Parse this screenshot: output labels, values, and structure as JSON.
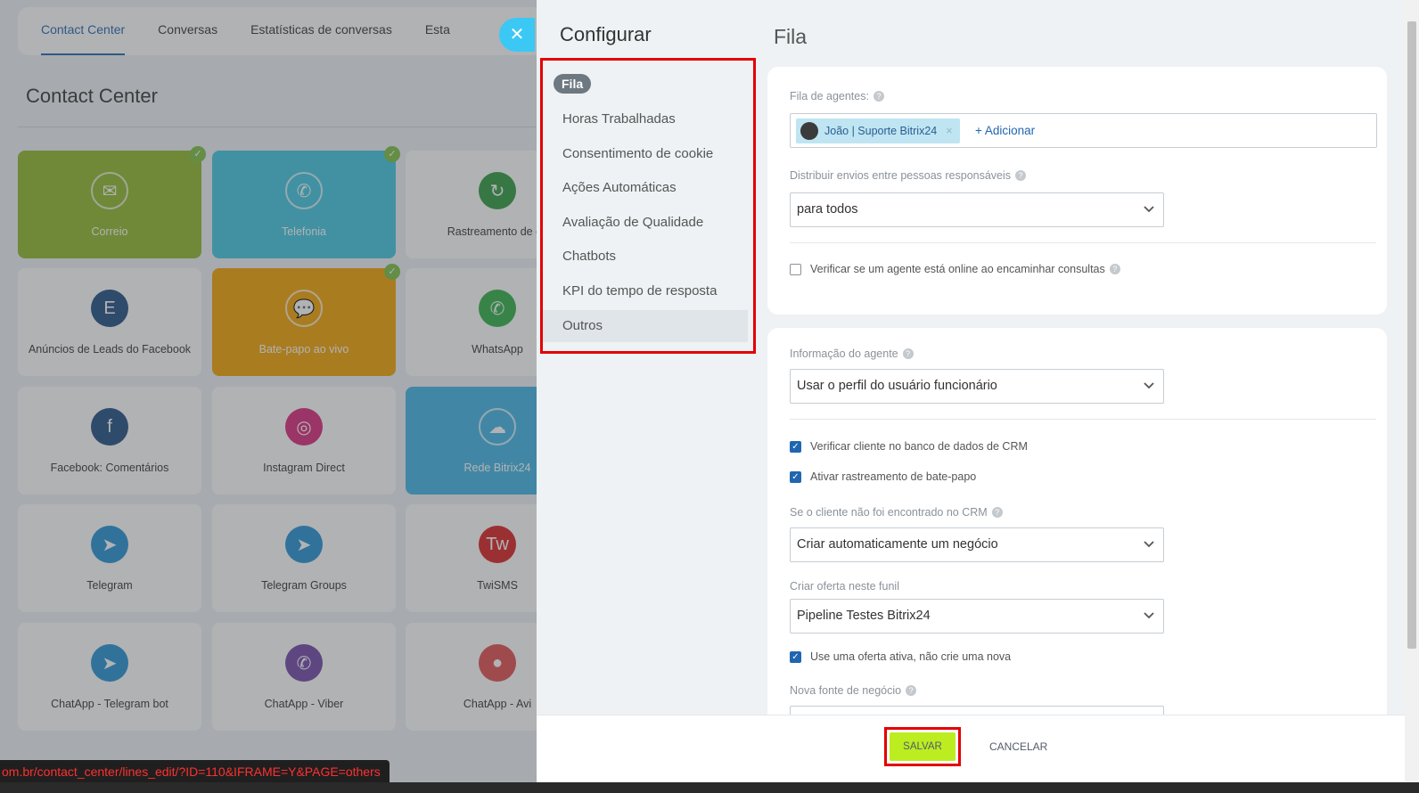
{
  "background": {
    "tabs": [
      "Contact Center",
      "Conversas",
      "Estatísticas de conversas",
      "Esta"
    ],
    "active_tab": "Contact Center",
    "page_title": "Contact Center",
    "tiles": [
      {
        "label": "Correio",
        "color": "#8db82a",
        "icon": "mail-icon",
        "glyph": "✉",
        "checked": true
      },
      {
        "label": "Telefonia",
        "color": "#3fc6e0",
        "icon": "phone-icon",
        "glyph": "✆",
        "checked": true
      },
      {
        "label": "Rastreamento de ch",
        "color": "",
        "icon": "call-tracking-icon",
        "glyph": "↻",
        "checked": false
      },
      {
        "label": "Anúncios de Leads do Facebook",
        "color": "",
        "icon": "facebook-leads-icon",
        "glyph": "E",
        "checked": false
      },
      {
        "label": "Bate-papo ao vivo",
        "color": "#f2a200",
        "icon": "live-chat-icon",
        "glyph": "💬",
        "checked": true
      },
      {
        "label": "WhatsApp",
        "color": "",
        "icon": "whatsapp-icon",
        "glyph": "✆",
        "checked": false
      },
      {
        "label": "Facebook: Comentários",
        "color": "",
        "icon": "facebook-comments-icon",
        "glyph": "f",
        "checked": false
      },
      {
        "label": "Instagram Direct",
        "color": "",
        "icon": "instagram-icon",
        "glyph": "◎",
        "checked": false
      },
      {
        "label": "Rede Bitrix24",
        "color": "#3fb6e6",
        "icon": "cloud-icon",
        "glyph": "☁",
        "checked": false
      },
      {
        "label": "Telegram",
        "color": "",
        "icon": "telegram-icon",
        "glyph": "➤",
        "checked": false
      },
      {
        "label": "Telegram Groups",
        "color": "",
        "icon": "telegram-groups-icon",
        "glyph": "➤",
        "checked": false
      },
      {
        "label": "TwiSMS",
        "color": "",
        "icon": "twisms-icon",
        "glyph": "Tw",
        "checked": false
      },
      {
        "label": "ChatApp - Telegram bot",
        "color": "",
        "icon": "telegram-bot-icon",
        "glyph": "➤",
        "checked": false
      },
      {
        "label": "ChatApp - Viber",
        "color": "",
        "icon": "viber-icon",
        "glyph": "✆",
        "checked": false
      },
      {
        "label": "ChatApp - Avi",
        "color": "",
        "icon": "avito-icon",
        "glyph": "●",
        "checked": false
      }
    ],
    "icon_colors": [
      "#8db82a",
      "#3fc6e0",
      "#2e9a3e",
      "#1f4f82",
      "#f2a200",
      "#2fb046",
      "#1f4f82",
      "#d9267a",
      "#3fb6e6",
      "#2492d4",
      "#2492d4",
      "#d92020",
      "#2492d4",
      "#7047a8",
      "#e04e4e"
    ],
    "status_url": "om.br/contact_center/lines_edit/?ID=110&IFRAME=Y&PAGE=others"
  },
  "panel": {
    "title": "Configurar",
    "nav": [
      "Fila",
      "Horas Trabalhadas",
      "Consentimento de cookie",
      "Ações Automáticas",
      "Avaliação de Qualidade",
      "Chatbots",
      "KPI do tempo de resposta",
      "Outros"
    ],
    "section_title": "Fila",
    "queue": {
      "label": "Fila de agentes:",
      "agent": "João | Suporte Bitrix24",
      "add_label": "+ Adicionar",
      "distribute_label": "Distribuir envios entre pessoas responsáveis",
      "distribute_value": "para todos",
      "check_online": "Verificar se um agente está online ao encaminhar consultas",
      "check_online_checked": false
    },
    "agent_info": {
      "label": "Informação do agente",
      "value": "Usar o perfil do usuário funcionário",
      "check_crm": "Verificar cliente no banco de dados de CRM",
      "check_crm_checked": true,
      "tracking": "Ativar rastreamento de bate-papo",
      "tracking_checked": true,
      "not_found_label": "Se o cliente não foi encontrado no CRM",
      "not_found_value": "Criar automaticamente um negócio",
      "funnel_label": "Criar oferta neste funil",
      "funnel_value": "Pipeline Testes Bitrix24",
      "active_offer": "Use uma oferta ativa, não crie uma nova",
      "active_offer_checked": true,
      "source_label": "Nova fonte de negócio"
    },
    "footer": {
      "save": "SALVAR",
      "cancel": "CANCELAR"
    }
  },
  "colors": {
    "accent": "#2067b0",
    "save": "#bbed21",
    "highlight_border": "#e30000",
    "close": "#3bc8f5"
  }
}
